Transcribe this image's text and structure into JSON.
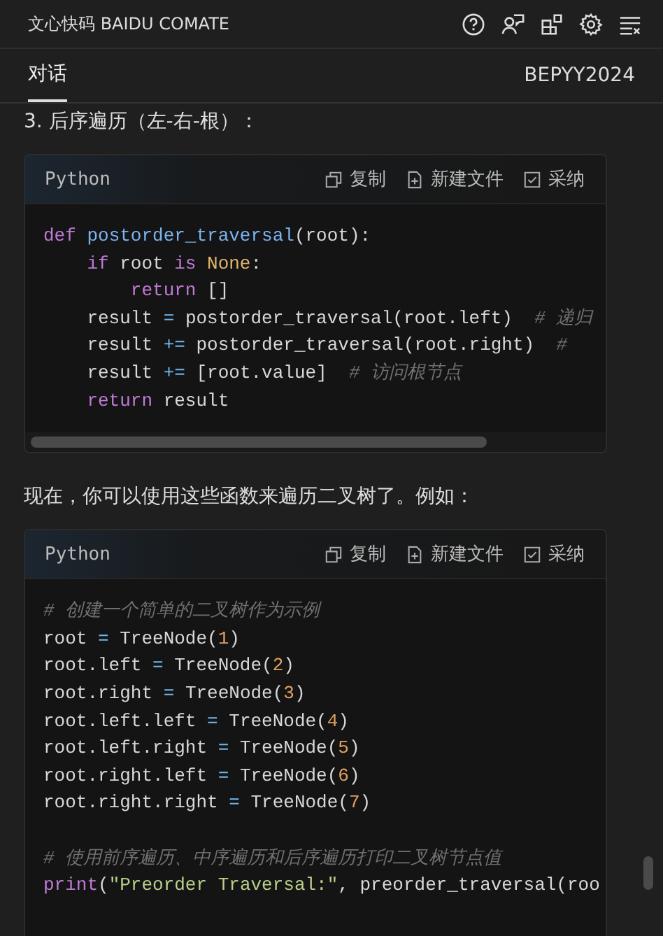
{
  "header": {
    "title": "文心快码 BAIDU COMATE"
  },
  "tabs": [
    {
      "label": "对话",
      "selected": true
    }
  ],
  "user": "BEPYY2024",
  "messages": [
    {
      "kind": "text",
      "text": "3. 后序遍历（左-右-根）："
    },
    {
      "kind": "code",
      "language": "Python",
      "actions": [
        "复制",
        "新建文件",
        "采纳"
      ],
      "scrollbar": true,
      "lines": [
        {
          "gap_before": false,
          "tokens": [
            {
              "t": "def ",
              "kind": "kw"
            },
            {
              "t": "postorder_traversal",
              "kind": "fn"
            },
            {
              "t": "(root):",
              "kind": "plain"
            }
          ]
        },
        {
          "gap_before": false,
          "tokens": [
            {
              "t": "    if ",
              "kind": "kw"
            },
            {
              "t": "root ",
              "kind": "plain"
            },
            {
              "t": "is ",
              "kind": "kw"
            },
            {
              "t": "None",
              "kind": "const"
            },
            {
              "t": ":",
              "kind": "plain"
            }
          ]
        },
        {
          "gap_before": false,
          "tokens": [
            {
              "t": "        return ",
              "kind": "kw"
            },
            {
              "t": "[]",
              "kind": "plain"
            }
          ]
        },
        {
          "gap_before": false,
          "tokens": [
            {
              "t": "    result ",
              "kind": "plain"
            },
            {
              "t": "= ",
              "kind": "op"
            },
            {
              "t": "postorder_traversal(root.left)  ",
              "kind": "plain"
            },
            {
              "t": "# 递归",
              "kind": "comment"
            }
          ]
        },
        {
          "gap_before": false,
          "tokens": [
            {
              "t": "    result ",
              "kind": "plain"
            },
            {
              "t": "+= ",
              "kind": "op"
            },
            {
              "t": "postorder_traversal(root.right)  ",
              "kind": "plain"
            },
            {
              "t": "#",
              "kind": "comment"
            }
          ]
        },
        {
          "gap_before": false,
          "tokens": [
            {
              "t": "    result ",
              "kind": "plain"
            },
            {
              "t": "+= ",
              "kind": "op"
            },
            {
              "t": "[root.value]  ",
              "kind": "plain"
            },
            {
              "t": "# 访问根节点",
              "kind": "comment"
            }
          ]
        },
        {
          "gap_before": false,
          "tokens": [
            {
              "t": "    return ",
              "kind": "kw"
            },
            {
              "t": "result",
              "kind": "plain"
            }
          ]
        }
      ]
    },
    {
      "kind": "text",
      "text": "现在，你可以使用这些函数来遍历二叉树了。例如："
    },
    {
      "kind": "code",
      "language": "Python",
      "actions": [
        "复制",
        "新建文件",
        "采纳"
      ],
      "scrollbar": false,
      "lines": [
        {
          "gap_before": false,
          "tokens": [
            {
              "t": "# 创建一个简单的二叉树作为示例",
              "kind": "comment"
            }
          ]
        },
        {
          "gap_before": false,
          "tokens": [
            {
              "t": "root ",
              "kind": "plain"
            },
            {
              "t": "= ",
              "kind": "op"
            },
            {
              "t": "TreeNode(",
              "kind": "plain"
            },
            {
              "t": "1",
              "kind": "num"
            },
            {
              "t": ")",
              "kind": "plain"
            }
          ]
        },
        {
          "gap_before": false,
          "tokens": [
            {
              "t": "root.left ",
              "kind": "plain"
            },
            {
              "t": "= ",
              "kind": "op"
            },
            {
              "t": "TreeNode(",
              "kind": "plain"
            },
            {
              "t": "2",
              "kind": "num"
            },
            {
              "t": ")",
              "kind": "plain"
            }
          ]
        },
        {
          "gap_before": false,
          "tokens": [
            {
              "t": "root.right ",
              "kind": "plain"
            },
            {
              "t": "= ",
              "kind": "op"
            },
            {
              "t": "TreeNode(",
              "kind": "plain"
            },
            {
              "t": "3",
              "kind": "num"
            },
            {
              "t": ")",
              "kind": "plain"
            }
          ]
        },
        {
          "gap_before": false,
          "tokens": [
            {
              "t": "root.left.left ",
              "kind": "plain"
            },
            {
              "t": "= ",
              "kind": "op"
            },
            {
              "t": "TreeNode(",
              "kind": "plain"
            },
            {
              "t": "4",
              "kind": "num"
            },
            {
              "t": ")",
              "kind": "plain"
            }
          ]
        },
        {
          "gap_before": false,
          "tokens": [
            {
              "t": "root.left.right ",
              "kind": "plain"
            },
            {
              "t": "= ",
              "kind": "op"
            },
            {
              "t": "TreeNode(",
              "kind": "plain"
            },
            {
              "t": "5",
              "kind": "num"
            },
            {
              "t": ")",
              "kind": "plain"
            }
          ]
        },
        {
          "gap_before": false,
          "tokens": [
            {
              "t": "root.right.left ",
              "kind": "plain"
            },
            {
              "t": "= ",
              "kind": "op"
            },
            {
              "t": "TreeNode(",
              "kind": "plain"
            },
            {
              "t": "6",
              "kind": "num"
            },
            {
              "t": ")",
              "kind": "plain"
            }
          ]
        },
        {
          "gap_before": false,
          "tokens": [
            {
              "t": "root.right.right ",
              "kind": "plain"
            },
            {
              "t": "= ",
              "kind": "op"
            },
            {
              "t": "TreeNode(",
              "kind": "plain"
            },
            {
              "t": "7",
              "kind": "num"
            },
            {
              "t": ")",
              "kind": "plain"
            }
          ]
        },
        {
          "gap_before": true,
          "tokens": [
            {
              "t": "# 使用前序遍历、中序遍历和后序遍历打印二叉树节点值",
              "kind": "comment"
            }
          ]
        },
        {
          "gap_before": false,
          "tokens": [
            {
              "t": "print",
              "kind": "kw"
            },
            {
              "t": "(",
              "kind": "plain"
            },
            {
              "t": "\"Preorder Traversal:\"",
              "kind": "str"
            },
            {
              "t": ", preorder_traversal(roo",
              "kind": "plain"
            }
          ]
        }
      ]
    }
  ]
}
